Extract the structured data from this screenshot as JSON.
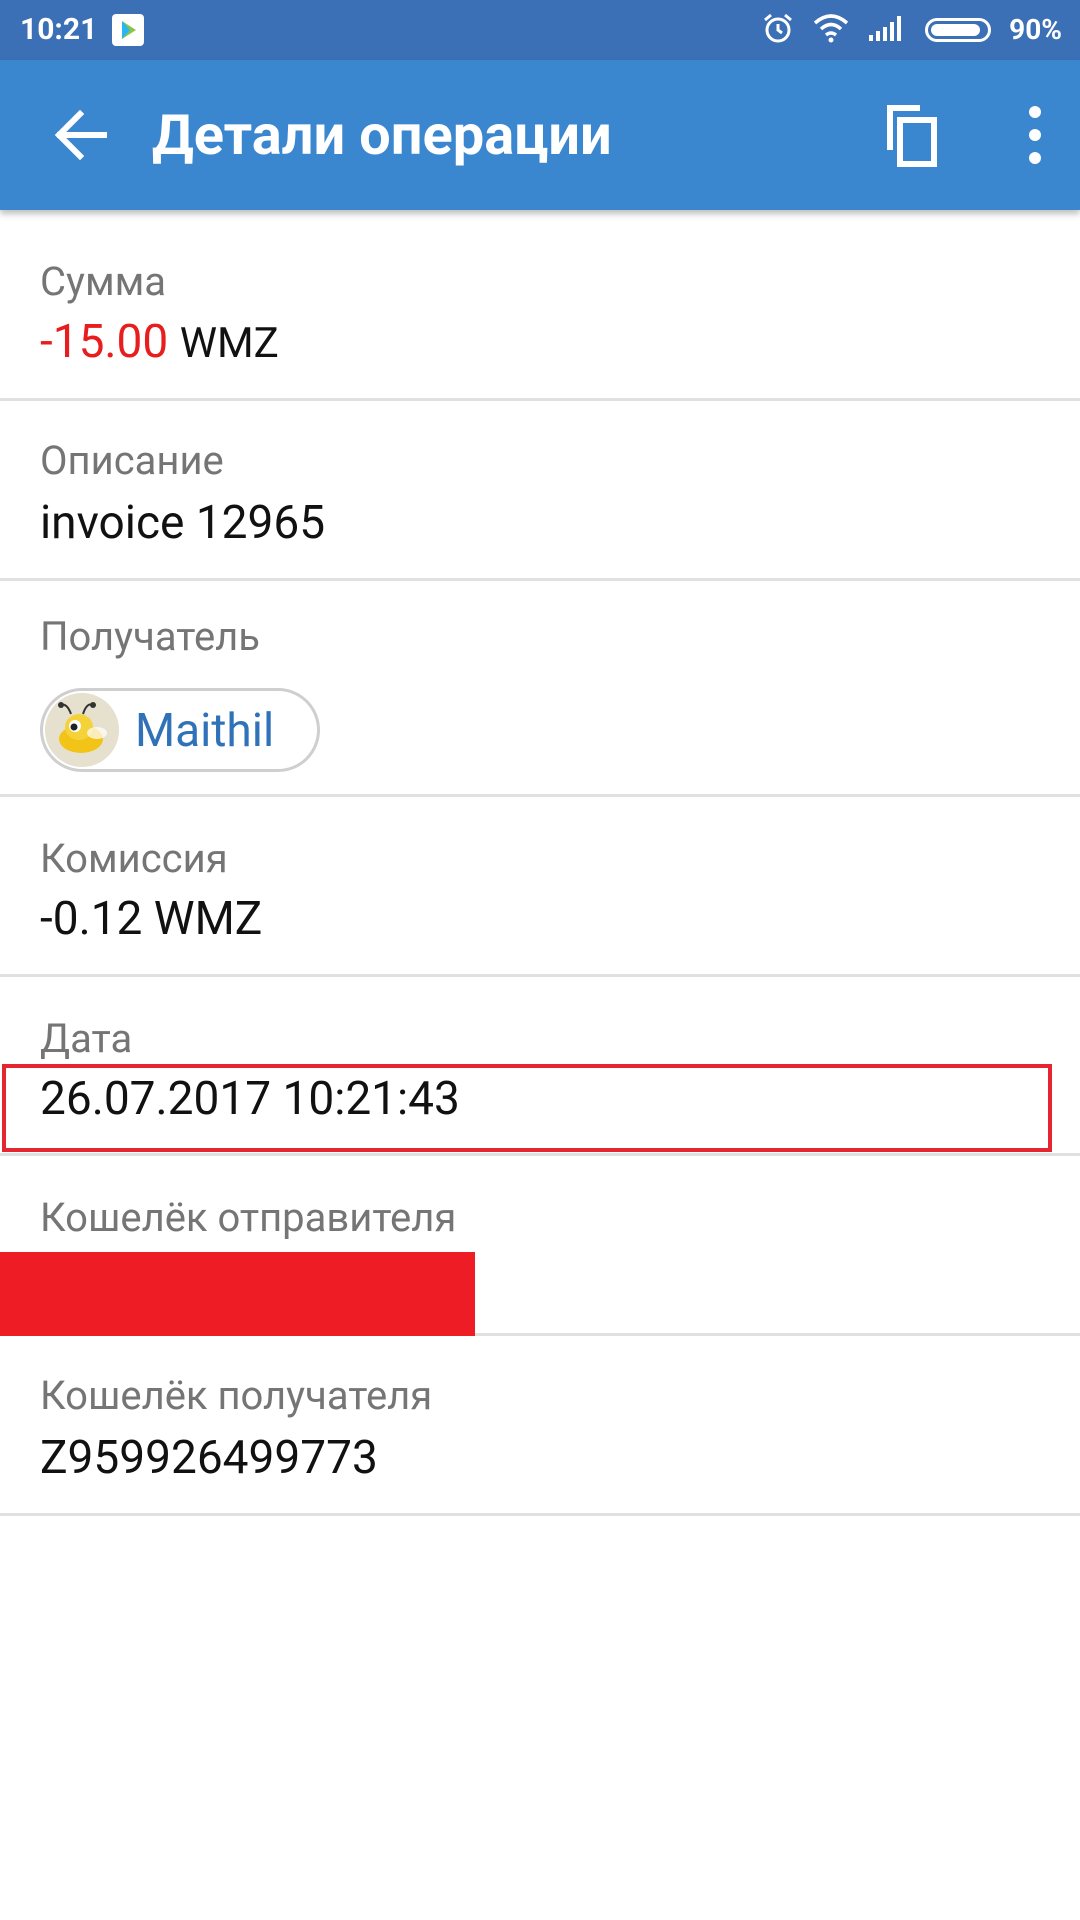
{
  "status_bar": {
    "time": "10:21",
    "battery_percent": "90%",
    "battery_level": 0.9,
    "icons": [
      "play-store-icon",
      "alarm-icon",
      "wifi-icon",
      "signal-icon",
      "battery-icon"
    ]
  },
  "app_bar": {
    "title": "Детали операции",
    "back_icon": "arrow-back-icon",
    "copy_icon": "copy-icon",
    "more_icon": "more-vert-icon"
  },
  "colors": {
    "status_bar": "#3b6fb6",
    "app_bar": "#3a86cf",
    "negative_amount": "#e81d1d",
    "link": "#2f72b8",
    "highlight": "#e3262f",
    "redaction": "#ee1c25"
  },
  "details": {
    "amount": {
      "label": "Сумма",
      "value": "-15.00",
      "currency": "WMZ"
    },
    "description": {
      "label": "Описание",
      "value": "invoice 12965"
    },
    "recipient": {
      "label": "Получатель",
      "name": "Maithil",
      "avatar_icon": "bee-avatar-icon"
    },
    "fee": {
      "label": "Комиссия",
      "value": "-0.12 WMZ"
    },
    "date": {
      "label": "Дата",
      "value": "26.07.2017 10:21:43"
    },
    "sender_wallet": {
      "label": "Кошелёк отправителя",
      "value": ""
    },
    "recipient_wallet": {
      "label": "Кошелёк получателя",
      "value": "Z959926499773"
    }
  }
}
